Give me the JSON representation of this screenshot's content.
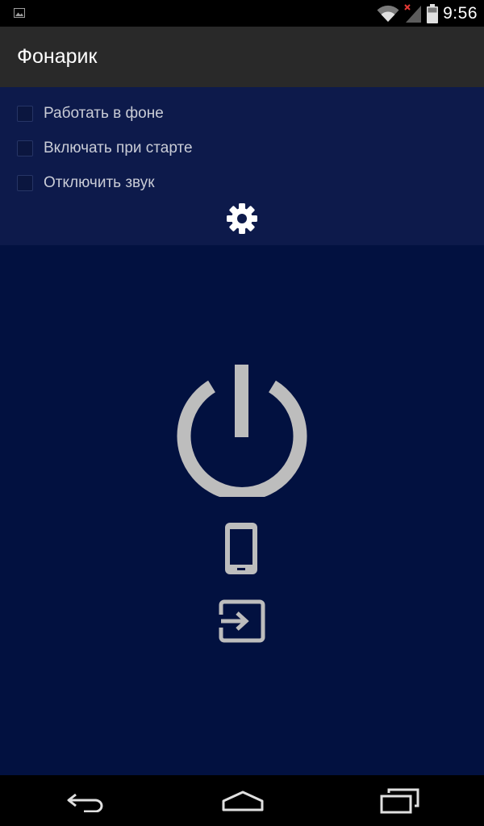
{
  "status_bar": {
    "time": "9:56",
    "icons": [
      "image-notification-icon",
      "wifi-icon",
      "signal-no-service-icon",
      "battery-icon"
    ]
  },
  "action_bar": {
    "title": "Фонарик"
  },
  "settings": {
    "checkboxes": [
      {
        "label": "Работать в фоне",
        "checked": false
      },
      {
        "label": "Включать при старте",
        "checked": false
      },
      {
        "label": "Отключить звук",
        "checked": false
      }
    ],
    "settings_icon": "gear-icon"
  },
  "controls": {
    "power_icon": "power-icon",
    "screen_light_icon": "phone-icon",
    "exit_icon": "exit-icon"
  },
  "nav_bar": {
    "icons": [
      "back-icon",
      "home-icon",
      "recent-apps-icon"
    ]
  },
  "colors": {
    "action_bar": "#292929",
    "settings_panel": "#0d1a4b",
    "main_background": "#021140",
    "icon_gray": "#bdbdbd",
    "label_text": "#c9ccd6"
  }
}
